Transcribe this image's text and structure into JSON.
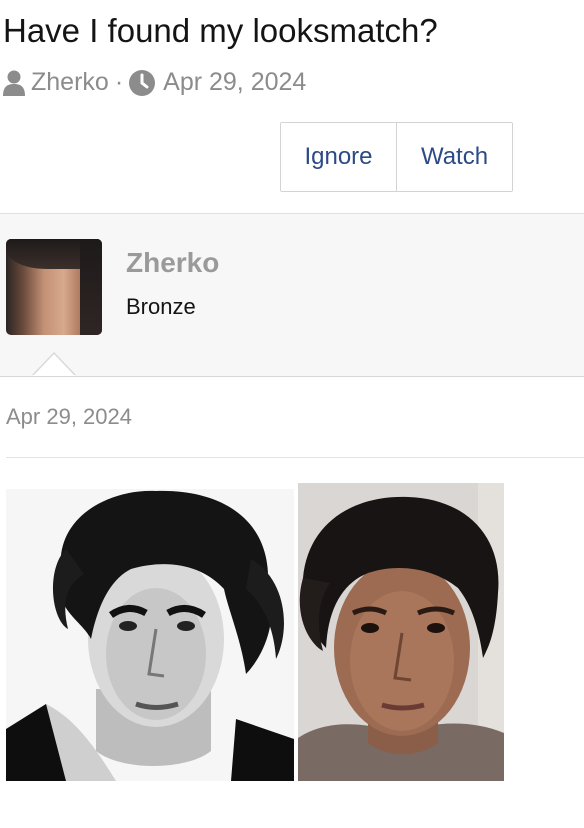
{
  "thread": {
    "title": "Have I found my looksmatch?",
    "author": "Zherko",
    "date": "Apr 29, 2024",
    "separator": "·"
  },
  "actions": {
    "ignore_label": "Ignore",
    "watch_label": "Watch"
  },
  "post": {
    "user": {
      "name": "Zherko",
      "rank": "Bronze"
    },
    "date": "Apr 29, 2024",
    "images": [
      {
        "description": "black-and-white portrait photo"
      },
      {
        "description": "color selfie photo"
      }
    ]
  },
  "colors": {
    "link": "#2c4a86",
    "muted": "#8c8c8c",
    "username": "#9a9a9a",
    "panel_bg": "#f7f7f7"
  },
  "icons": {
    "author": "user-icon",
    "date": "clock-icon"
  }
}
